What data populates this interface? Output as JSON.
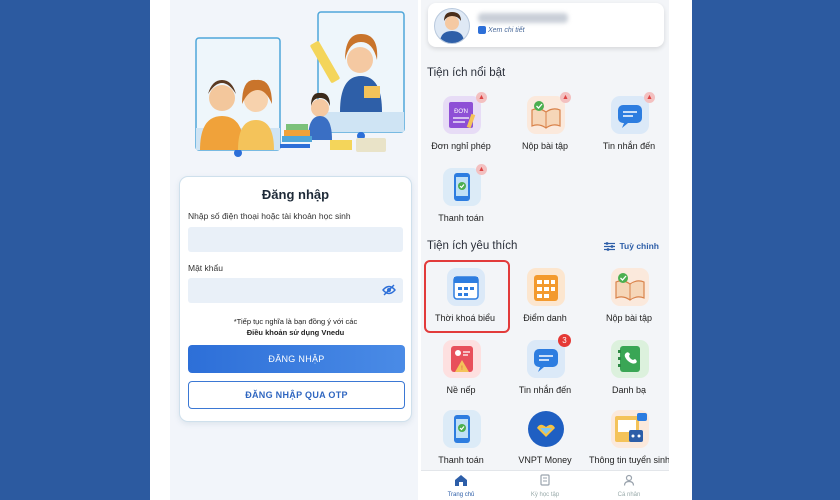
{
  "login": {
    "title": "Đăng nhập",
    "phone_label": "Nhập số điện thoại hoặc tài khoản học sinh",
    "phone_value": "",
    "password_label": "Mật khẩu",
    "password_value": "",
    "terms_line1": "*Tiếp tục nghĩa là bạn đồng ý với các",
    "terms_line2": "Điều khoản sử dụng Vnedu",
    "login_button": "ĐĂNG NHẬP",
    "otp_button": "ĐĂNG NHẬP QUA OTP"
  },
  "profile": {
    "detail_link": "Xem chi tiết"
  },
  "featured": {
    "title": "Tiện ích nổi bật",
    "items": [
      {
        "label": "Đơn nghỉ phép",
        "icon": "leave-form-icon",
        "icon_text": "ĐƠN"
      },
      {
        "label": "Nộp bài tập",
        "icon": "homework-book-icon"
      },
      {
        "label": "Tin nhắn đến",
        "icon": "message-icon"
      },
      {
        "label": "Thanh toán",
        "icon": "phone-payment-icon"
      }
    ]
  },
  "favorites": {
    "title": "Tiện ích yêu thích",
    "customize": "Tuỳ chỉnh",
    "items": [
      {
        "label": "Thời khoá biểu",
        "icon": "calendar-icon",
        "highlighted": true
      },
      {
        "label": "Điểm danh",
        "icon": "attendance-icon"
      },
      {
        "label": "Nộp bài tập",
        "icon": "homework-book-icon"
      },
      {
        "label": "Nề nếp",
        "icon": "conduct-icon"
      },
      {
        "label": "Tin nhắn đến",
        "icon": "message-icon",
        "badge": "3"
      },
      {
        "label": "Danh bạ",
        "icon": "contacts-icon"
      },
      {
        "label": "Thanh toán",
        "icon": "phone-payment-icon"
      },
      {
        "label": "VNPT Money",
        "icon": "vnpt-money-icon"
      },
      {
        "label": "Thông tin tuyển sinh",
        "icon": "enrollment-info-icon"
      }
    ]
  },
  "bottom_nav": [
    {
      "label": "Trang chủ",
      "icon": "home-icon",
      "active": true
    },
    {
      "label": "Kỳ học tập",
      "icon": "study-term-icon"
    },
    {
      "label": "Cá nhân",
      "icon": "person-icon"
    }
  ],
  "colors": {
    "background": "#2c5aa0",
    "primary_button": "#2d6fd8",
    "highlight_border": "#e23b3b",
    "badge": "#e53935"
  }
}
